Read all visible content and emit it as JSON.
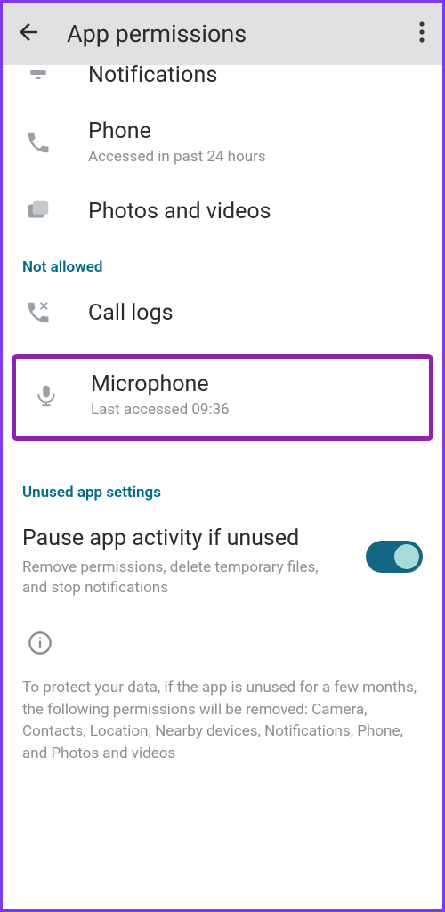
{
  "header": {
    "title": "App permissions"
  },
  "permissions": {
    "notifications": {
      "label": "Notifications"
    },
    "phone": {
      "label": "Phone",
      "sub": "Accessed in past 24 hours"
    },
    "photos": {
      "label": "Photos and videos"
    }
  },
  "sections": {
    "not_allowed": "Not allowed",
    "unused": "Unused app settings"
  },
  "not_allowed_items": {
    "call_logs": {
      "label": "Call logs"
    },
    "microphone": {
      "label": "Microphone",
      "sub": "Last accessed 09:36"
    }
  },
  "pause": {
    "title": "Pause app activity if unused",
    "desc": "Remove permissions, delete temporary files, and stop notifications",
    "enabled": true
  },
  "footer": "To protect your data, if the app is unused for a few months, the following permissions will be removed: Camera, Contacts, Location, Nearby devices, Notifications, Phone, and Photos and videos",
  "colors": {
    "accent": "#126782",
    "highlight": "#8e24aa"
  }
}
